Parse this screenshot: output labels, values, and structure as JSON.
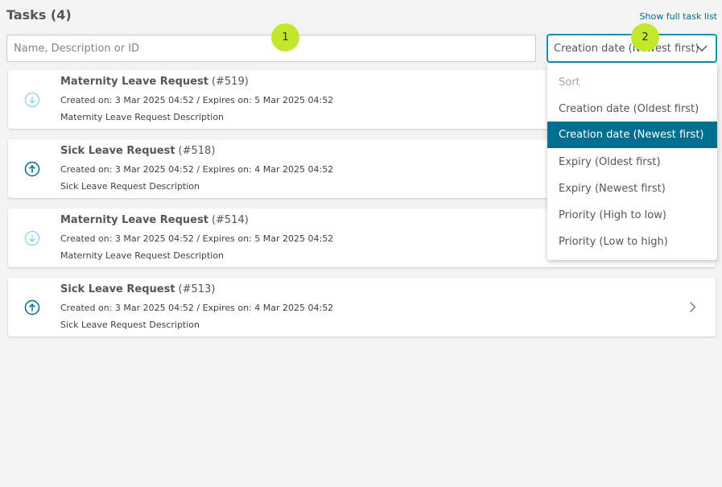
{
  "header": {
    "title": "Tasks (4)",
    "full_list_link": "Show full task list"
  },
  "search": {
    "placeholder": "Name, Description or ID",
    "value": ""
  },
  "sort": {
    "selected": "Creation date (Newest first)",
    "header": "Sort",
    "options": [
      "Creation date (Oldest first)",
      "Creation date (Newest first)",
      "Expiry (Oldest first)",
      "Expiry (Newest first)",
      "Priority (High to low)",
      "Priority (Low to high)"
    ]
  },
  "badges": [
    "1",
    "2"
  ],
  "tasks": [
    {
      "name": "Maternity Leave Request",
      "id": "(#519)",
      "dates": "Created on: 3 Mar 2025 04:52 / Expires on: 5 Mar 2025 04:52",
      "description": "Maternity Leave Request Description",
      "priority_icon": "arrow-down-circle-icon"
    },
    {
      "name": "Sick Leave Request",
      "id": "(#518)",
      "dates": "Created on: 3 Mar 2025 04:52 / Expires on: 4 Mar 2025 04:52",
      "description": "Sick Leave Request Description",
      "priority_icon": "arrow-up-circle-icon"
    },
    {
      "name": "Maternity Leave Request",
      "id": "(#514)",
      "dates": "Created on: 3 Mar 2025 04:52 / Expires on: 5 Mar 2025 04:52",
      "description": "Maternity Leave Request Description",
      "priority_icon": "arrow-down-circle-icon"
    },
    {
      "name": "Sick Leave Request",
      "id": "(#513)",
      "dates": "Created on: 3 Mar 2025 04:52 / Expires on: 4 Mar 2025 04:52",
      "description": "Sick Leave Request Description",
      "priority_icon": "arrow-up-circle-icon"
    }
  ],
  "colors": {
    "accent": "#006e8f",
    "focus_border": "#0f92b3",
    "badge": "#c3e82b",
    "low_priority_icon": "#8fd3e3",
    "high_priority_icon": "#006e8f"
  }
}
